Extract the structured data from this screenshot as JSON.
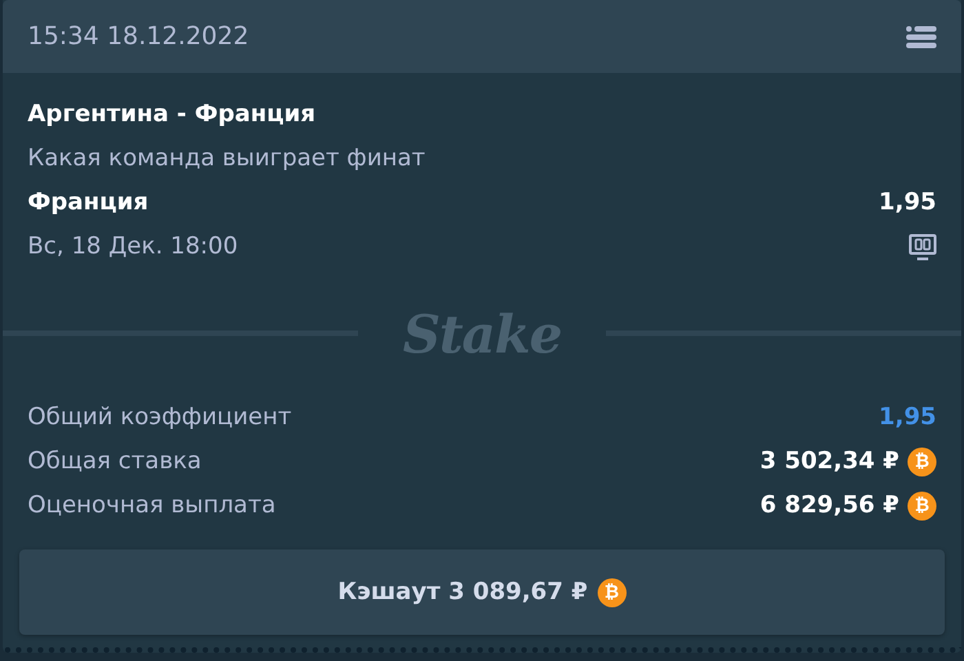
{
  "header": {
    "datetime": "15:34 18.12.2022"
  },
  "bet": {
    "match": "Аргентина - Франция",
    "market": "Какая команда выиграет финат",
    "selection": "Франция",
    "odds": "1,95",
    "start_time": "Вс, 18 Дек. 18:00"
  },
  "logo": "Stake",
  "summary": [
    {
      "label": "Общий коэффициент",
      "value": "1,95",
      "kind": "odds"
    },
    {
      "label": "Общая ставка",
      "value": "3 502,34 ₽",
      "kind": "amount",
      "currency_icon": "₿"
    },
    {
      "label": "Оценочная выплата",
      "value": "6 829,56 ₽",
      "kind": "amount",
      "currency_icon": "₿"
    }
  ],
  "cashout_button": {
    "label": "Кэшаут 3 089,67 ₽",
    "currency_icon": "₿"
  }
}
